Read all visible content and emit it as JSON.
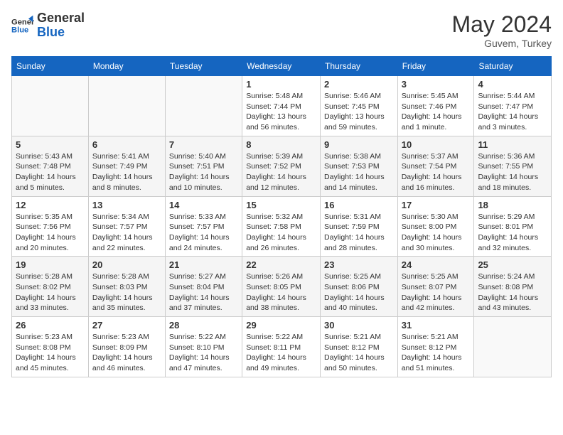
{
  "logo": {
    "line1": "General",
    "line2": "Blue"
  },
  "title": "May 2024",
  "location": "Guvem, Turkey",
  "headers": [
    "Sunday",
    "Monday",
    "Tuesday",
    "Wednesday",
    "Thursday",
    "Friday",
    "Saturday"
  ],
  "weeks": [
    [
      {
        "num": "",
        "sunrise": "",
        "sunset": "",
        "daylight": ""
      },
      {
        "num": "",
        "sunrise": "",
        "sunset": "",
        "daylight": ""
      },
      {
        "num": "",
        "sunrise": "",
        "sunset": "",
        "daylight": ""
      },
      {
        "num": "1",
        "sunrise": "Sunrise: 5:48 AM",
        "sunset": "Sunset: 7:44 PM",
        "daylight": "Daylight: 13 hours and 56 minutes."
      },
      {
        "num": "2",
        "sunrise": "Sunrise: 5:46 AM",
        "sunset": "Sunset: 7:45 PM",
        "daylight": "Daylight: 13 hours and 59 minutes."
      },
      {
        "num": "3",
        "sunrise": "Sunrise: 5:45 AM",
        "sunset": "Sunset: 7:46 PM",
        "daylight": "Daylight: 14 hours and 1 minute."
      },
      {
        "num": "4",
        "sunrise": "Sunrise: 5:44 AM",
        "sunset": "Sunset: 7:47 PM",
        "daylight": "Daylight: 14 hours and 3 minutes."
      }
    ],
    [
      {
        "num": "5",
        "sunrise": "Sunrise: 5:43 AM",
        "sunset": "Sunset: 7:48 PM",
        "daylight": "Daylight: 14 hours and 5 minutes."
      },
      {
        "num": "6",
        "sunrise": "Sunrise: 5:41 AM",
        "sunset": "Sunset: 7:49 PM",
        "daylight": "Daylight: 14 hours and 8 minutes."
      },
      {
        "num": "7",
        "sunrise": "Sunrise: 5:40 AM",
        "sunset": "Sunset: 7:51 PM",
        "daylight": "Daylight: 14 hours and 10 minutes."
      },
      {
        "num": "8",
        "sunrise": "Sunrise: 5:39 AM",
        "sunset": "Sunset: 7:52 PM",
        "daylight": "Daylight: 14 hours and 12 minutes."
      },
      {
        "num": "9",
        "sunrise": "Sunrise: 5:38 AM",
        "sunset": "Sunset: 7:53 PM",
        "daylight": "Daylight: 14 hours and 14 minutes."
      },
      {
        "num": "10",
        "sunrise": "Sunrise: 5:37 AM",
        "sunset": "Sunset: 7:54 PM",
        "daylight": "Daylight: 14 hours and 16 minutes."
      },
      {
        "num": "11",
        "sunrise": "Sunrise: 5:36 AM",
        "sunset": "Sunset: 7:55 PM",
        "daylight": "Daylight: 14 hours and 18 minutes."
      }
    ],
    [
      {
        "num": "12",
        "sunrise": "Sunrise: 5:35 AM",
        "sunset": "Sunset: 7:56 PM",
        "daylight": "Daylight: 14 hours and 20 minutes."
      },
      {
        "num": "13",
        "sunrise": "Sunrise: 5:34 AM",
        "sunset": "Sunset: 7:57 PM",
        "daylight": "Daylight: 14 hours and 22 minutes."
      },
      {
        "num": "14",
        "sunrise": "Sunrise: 5:33 AM",
        "sunset": "Sunset: 7:57 PM",
        "daylight": "Daylight: 14 hours and 24 minutes."
      },
      {
        "num": "15",
        "sunrise": "Sunrise: 5:32 AM",
        "sunset": "Sunset: 7:58 PM",
        "daylight": "Daylight: 14 hours and 26 minutes."
      },
      {
        "num": "16",
        "sunrise": "Sunrise: 5:31 AM",
        "sunset": "Sunset: 7:59 PM",
        "daylight": "Daylight: 14 hours and 28 minutes."
      },
      {
        "num": "17",
        "sunrise": "Sunrise: 5:30 AM",
        "sunset": "Sunset: 8:00 PM",
        "daylight": "Daylight: 14 hours and 30 minutes."
      },
      {
        "num": "18",
        "sunrise": "Sunrise: 5:29 AM",
        "sunset": "Sunset: 8:01 PM",
        "daylight": "Daylight: 14 hours and 32 minutes."
      }
    ],
    [
      {
        "num": "19",
        "sunrise": "Sunrise: 5:28 AM",
        "sunset": "Sunset: 8:02 PM",
        "daylight": "Daylight: 14 hours and 33 minutes."
      },
      {
        "num": "20",
        "sunrise": "Sunrise: 5:28 AM",
        "sunset": "Sunset: 8:03 PM",
        "daylight": "Daylight: 14 hours and 35 minutes."
      },
      {
        "num": "21",
        "sunrise": "Sunrise: 5:27 AM",
        "sunset": "Sunset: 8:04 PM",
        "daylight": "Daylight: 14 hours and 37 minutes."
      },
      {
        "num": "22",
        "sunrise": "Sunrise: 5:26 AM",
        "sunset": "Sunset: 8:05 PM",
        "daylight": "Daylight: 14 hours and 38 minutes."
      },
      {
        "num": "23",
        "sunrise": "Sunrise: 5:25 AM",
        "sunset": "Sunset: 8:06 PM",
        "daylight": "Daylight: 14 hours and 40 minutes."
      },
      {
        "num": "24",
        "sunrise": "Sunrise: 5:25 AM",
        "sunset": "Sunset: 8:07 PM",
        "daylight": "Daylight: 14 hours and 42 minutes."
      },
      {
        "num": "25",
        "sunrise": "Sunrise: 5:24 AM",
        "sunset": "Sunset: 8:08 PM",
        "daylight": "Daylight: 14 hours and 43 minutes."
      }
    ],
    [
      {
        "num": "26",
        "sunrise": "Sunrise: 5:23 AM",
        "sunset": "Sunset: 8:08 PM",
        "daylight": "Daylight: 14 hours and 45 minutes."
      },
      {
        "num": "27",
        "sunrise": "Sunrise: 5:23 AM",
        "sunset": "Sunset: 8:09 PM",
        "daylight": "Daylight: 14 hours and 46 minutes."
      },
      {
        "num": "28",
        "sunrise": "Sunrise: 5:22 AM",
        "sunset": "Sunset: 8:10 PM",
        "daylight": "Daylight: 14 hours and 47 minutes."
      },
      {
        "num": "29",
        "sunrise": "Sunrise: 5:22 AM",
        "sunset": "Sunset: 8:11 PM",
        "daylight": "Daylight: 14 hours and 49 minutes."
      },
      {
        "num": "30",
        "sunrise": "Sunrise: 5:21 AM",
        "sunset": "Sunset: 8:12 PM",
        "daylight": "Daylight: 14 hours and 50 minutes."
      },
      {
        "num": "31",
        "sunrise": "Sunrise: 5:21 AM",
        "sunset": "Sunset: 8:12 PM",
        "daylight": "Daylight: 14 hours and 51 minutes."
      },
      {
        "num": "",
        "sunrise": "",
        "sunset": "",
        "daylight": ""
      }
    ]
  ]
}
